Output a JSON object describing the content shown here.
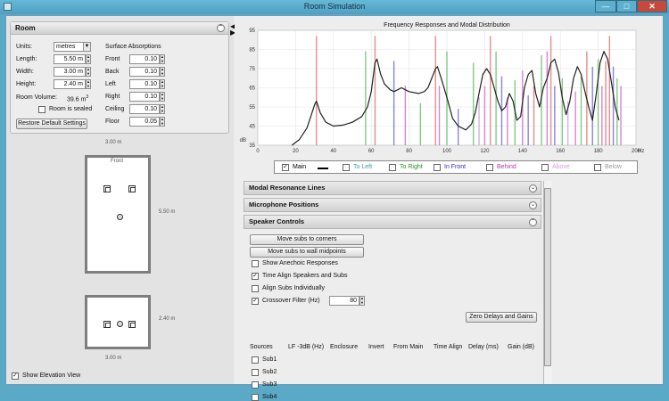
{
  "window": {
    "title": "Room Simulation"
  },
  "room_panel": {
    "title": "Room",
    "units_label": "Units:",
    "units_value": "metres",
    "length_label": "Length:",
    "length_value": "5.50 m",
    "width_label": "Width:",
    "width_value": "3.00 m",
    "height_label": "Height:",
    "height_value": "2.40 m",
    "volume_label": "Room Volume:",
    "volume_value": "39.6 m",
    "volume_sup": "3",
    "sealed_label": "Room is sealed",
    "restore_button": "Restore Default Settings",
    "absorption_title": "Surface Absorptions",
    "surfaces": [
      {
        "label": "Front",
        "value": "0.10"
      },
      {
        "label": "Back",
        "value": "0.10"
      },
      {
        "label": "Left",
        "value": "0.10"
      },
      {
        "label": "Right",
        "value": "0.10"
      },
      {
        "label": "Ceiling",
        "value": "0.10"
      },
      {
        "label": "Floor",
        "value": "0.05"
      }
    ]
  },
  "plan": {
    "width_dim": "3.00 m",
    "length_dim": "5.50 m",
    "front_label": "Front",
    "height_dim": "2.40 m",
    "elev_width_dim": "3.00 m",
    "elevation_label": "Show Elevation View"
  },
  "chart_data": {
    "type": "line",
    "title": "Frequency Responses and Modal Distribution",
    "y_unit_label": "dB",
    "x_unit_label": "Hz",
    "xlim": [
      0,
      200
    ],
    "ylim": [
      35,
      95
    ],
    "x_ticks": [
      0,
      20,
      40,
      60,
      80,
      100,
      120,
      140,
      160,
      180,
      200
    ],
    "y_ticks": [
      35,
      45,
      55,
      65,
      75,
      85,
      95
    ],
    "series": [
      {
        "name": "Main",
        "x": [
          18,
          22,
          26,
          28,
          30,
          31,
          33,
          36,
          40,
          45,
          50,
          55,
          58,
          60,
          62,
          63,
          65,
          67,
          70,
          72,
          74,
          76,
          78,
          80,
          85,
          88,
          90,
          92,
          94,
          95,
          97,
          100,
          103,
          106,
          110,
          113,
          115,
          117,
          119,
          121,
          123,
          125,
          127,
          129,
          131,
          133,
          135,
          137,
          139,
          141,
          143,
          145,
          147,
          149,
          151,
          153,
          155,
          157,
          159,
          161,
          163,
          165,
          167,
          169,
          171,
          173,
          175,
          177,
          179,
          181,
          183,
          185,
          187,
          189,
          191
        ],
        "y": [
          34,
          38,
          44,
          50,
          56,
          58,
          52,
          47,
          45,
          45.5,
          47,
          50,
          55,
          63,
          78,
          80,
          72,
          67,
          64,
          63,
          64,
          65,
          64,
          63,
          62,
          63,
          65,
          70,
          75,
          76,
          70,
          60,
          49,
          45,
          43,
          46,
          52,
          62,
          72,
          75,
          72,
          65,
          58,
          53,
          55,
          62,
          58,
          48,
          50,
          65,
          72,
          74,
          62,
          55,
          65,
          70,
          78,
          80,
          73,
          60,
          51,
          58,
          70,
          76,
          72,
          63,
          55,
          48,
          62,
          78,
          84,
          80,
          68,
          55,
          48
        ]
      }
    ],
    "mode_lines": [
      {
        "f": 31,
        "h": 92,
        "color": "#e07a7a"
      },
      {
        "f": 57,
        "h": 84,
        "color": "#6cc36c"
      },
      {
        "f": 62,
        "h": 92,
        "color": "#e07a7a"
      },
      {
        "f": 72,
        "h": 79,
        "color": "#7070e0"
      },
      {
        "f": 78,
        "h": 66,
        "color": "#d070d0"
      },
      {
        "f": 86,
        "h": 57,
        "color": "#6cc36c"
      },
      {
        "f": 94,
        "h": 92,
        "color": "#e07a7a"
      },
      {
        "f": 96,
        "h": 66,
        "color": "#d070d0"
      },
      {
        "f": 100,
        "h": 84,
        "color": "#6cc36c"
      },
      {
        "f": 106,
        "h": 54,
        "color": "#7070e0"
      },
      {
        "f": 114,
        "h": 78,
        "color": "#6cc36c"
      },
      {
        "f": 117,
        "h": 60,
        "color": "#c8a8e0"
      },
      {
        "f": 120,
        "h": 66,
        "color": "#d070d0"
      },
      {
        "f": 123,
        "h": 92,
        "color": "#e07a7a"
      },
      {
        "f": 126,
        "h": 84,
        "color": "#6cc36c"
      },
      {
        "f": 129,
        "h": 71,
        "color": "#7070e0"
      },
      {
        "f": 132,
        "h": 60,
        "color": "#d070d0"
      },
      {
        "f": 136,
        "h": 69,
        "color": "#6cc36c"
      },
      {
        "f": 140,
        "h": 74,
        "color": "#d070d0"
      },
      {
        "f": 143,
        "h": 61,
        "color": "#7070e0"
      },
      {
        "f": 146,
        "h": 66,
        "color": "#e07a7a"
      },
      {
        "f": 150,
        "h": 82,
        "color": "#6cc36c"
      },
      {
        "f": 153,
        "h": 84,
        "color": "#d070d0"
      },
      {
        "f": 155,
        "h": 92,
        "color": "#e07a7a"
      },
      {
        "f": 157,
        "h": 66,
        "color": "#7070e0"
      },
      {
        "f": 161,
        "h": 70,
        "color": "#6cc36c"
      },
      {
        "f": 164,
        "h": 58,
        "color": "#c8a8e0"
      },
      {
        "f": 168,
        "h": 63,
        "color": "#d070d0"
      },
      {
        "f": 171,
        "h": 71,
        "color": "#6cc36c"
      },
      {
        "f": 174,
        "h": 84,
        "color": "#e07a7a"
      },
      {
        "f": 177,
        "h": 76,
        "color": "#7070e0"
      },
      {
        "f": 180,
        "h": 80,
        "color": "#6cc36c"
      },
      {
        "f": 182,
        "h": 66,
        "color": "#d070d0"
      },
      {
        "f": 184,
        "h": 79,
        "color": "#e07a7a"
      },
      {
        "f": 186,
        "h": 92,
        "color": "#e07a7a"
      },
      {
        "f": 188,
        "h": 76,
        "color": "#7070e0"
      },
      {
        "f": 190,
        "h": 70,
        "color": "#6cc36c"
      },
      {
        "f": 192,
        "h": 66,
        "color": "#d070d0"
      }
    ],
    "grid": true
  },
  "legend": [
    {
      "label": "Main",
      "checked": true,
      "color": "#000000"
    },
    {
      "label": "To Left",
      "checked": false,
      "color": "#3aa0a0"
    },
    {
      "label": "To Right",
      "checked": false,
      "color": "#2f8f2f"
    },
    {
      "label": "In Front",
      "checked": false,
      "color": "#2f2fb0"
    },
    {
      "label": "Behind",
      "checked": false,
      "color": "#b03ab0"
    },
    {
      "label": "Above",
      "checked": false,
      "color": "#d59adf"
    },
    {
      "label": "Below",
      "checked": false,
      "color": "#9a9a9a"
    }
  ],
  "sections": {
    "modal": "Modal Resonance Lines",
    "mic": "Microphone Positions",
    "speaker": "Speaker Controls"
  },
  "speaker_controls": {
    "move_corners": "Move subs to corners",
    "move_walls": "Move subs to wall midpoints",
    "anechoic": "Show Anechoic Responses",
    "time_align": "Time Align Speakers and Subs",
    "align_subs": "Align Subs Individually",
    "crossover": "Crossover Filter (Hz)",
    "crossover_value": "80",
    "zero_button": "Zero Delays and Gains",
    "columns": [
      "Sources",
      "LF -3dB (Hz)",
      "Enclosure",
      "Invert",
      "From Main",
      "Time Align",
      "Delay (ms)",
      "Gain (dB)"
    ],
    "subs": [
      "Sub1",
      "Sub2",
      "Sub3",
      "Sub4"
    ]
  }
}
